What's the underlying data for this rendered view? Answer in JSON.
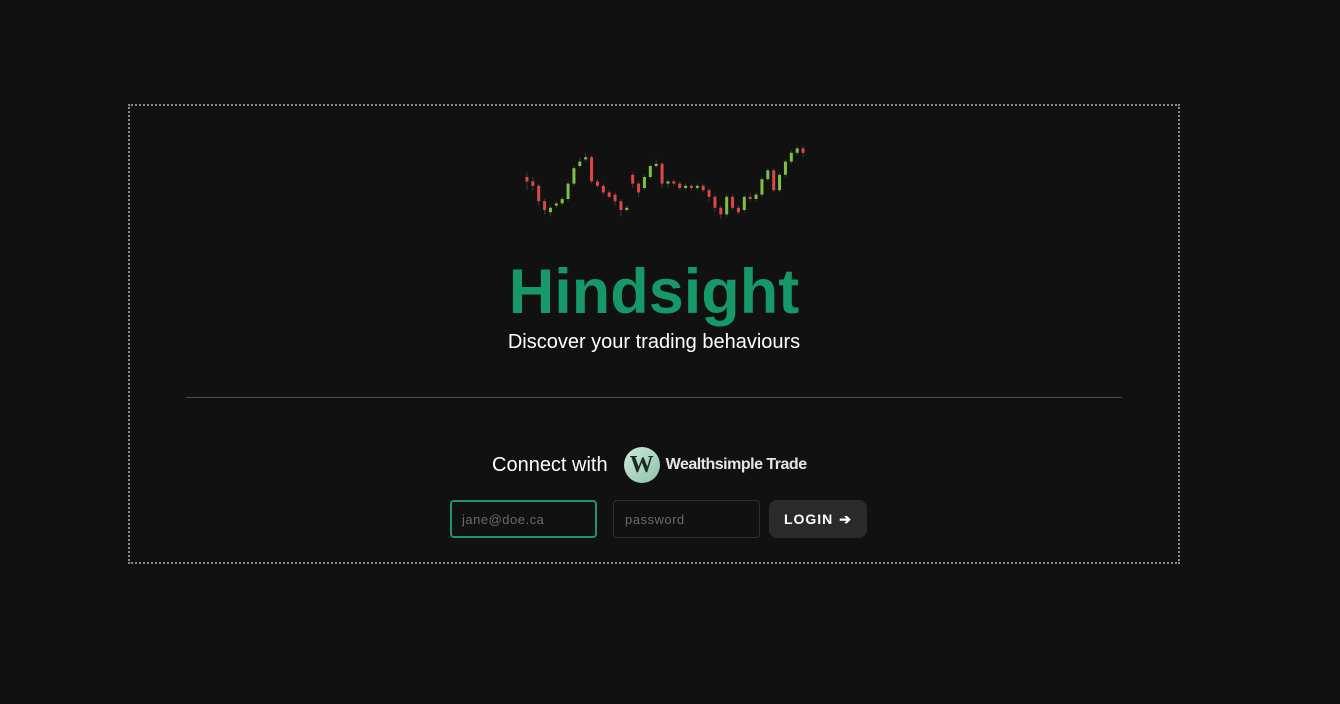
{
  "app": {
    "title": "Hindsight",
    "subtitle": "Discover your trading behaviours"
  },
  "logo": {
    "icon": "candlestick-chart-icon",
    "colors": {
      "up": "#7cc242",
      "down": "#e04646",
      "wick": "#3a3a3a"
    },
    "candles": [
      [
        0.7,
        0.66,
        0.58,
        0.74
      ],
      [
        0.66,
        0.62,
        0.58,
        0.7
      ],
      [
        0.62,
        0.48,
        0.44,
        0.64
      ],
      [
        0.48,
        0.4,
        0.36,
        0.5
      ],
      [
        0.38,
        0.42,
        0.34,
        0.44
      ],
      [
        0.44,
        0.46,
        0.42,
        0.48
      ],
      [
        0.46,
        0.5,
        0.44,
        0.52
      ],
      [
        0.5,
        0.64,
        0.48,
        0.66
      ],
      [
        0.64,
        0.78,
        0.62,
        0.8
      ],
      [
        0.8,
        0.84,
        0.78,
        0.88
      ],
      [
        0.86,
        0.88,
        0.84,
        0.92
      ],
      [
        0.88,
        0.66,
        0.64,
        0.9
      ],
      [
        0.66,
        0.62,
        0.6,
        0.68
      ],
      [
        0.62,
        0.56,
        0.54,
        0.64
      ],
      [
        0.56,
        0.52,
        0.5,
        0.58
      ],
      [
        0.54,
        0.48,
        0.44,
        0.56
      ],
      [
        0.48,
        0.4,
        0.34,
        0.5
      ],
      [
        0.4,
        0.42,
        0.38,
        0.44
      ],
      [
        0.72,
        0.64,
        0.6,
        0.74
      ],
      [
        0.64,
        0.56,
        0.52,
        0.66
      ],
      [
        0.6,
        0.7,
        0.58,
        0.72
      ],
      [
        0.7,
        0.8,
        0.68,
        0.82
      ],
      [
        0.8,
        0.82,
        0.78,
        0.86
      ],
      [
        0.82,
        0.64,
        0.6,
        0.84
      ],
      [
        0.64,
        0.66,
        0.6,
        0.68
      ],
      [
        0.66,
        0.64,
        0.62,
        0.68
      ],
      [
        0.64,
        0.6,
        0.58,
        0.66
      ],
      [
        0.6,
        0.62,
        0.58,
        0.64
      ],
      [
        0.62,
        0.6,
        0.58,
        0.64
      ],
      [
        0.6,
        0.62,
        0.58,
        0.64
      ],
      [
        0.62,
        0.58,
        0.56,
        0.64
      ],
      [
        0.58,
        0.52,
        0.48,
        0.6
      ],
      [
        0.52,
        0.42,
        0.38,
        0.54
      ],
      [
        0.42,
        0.36,
        0.32,
        0.44
      ],
      [
        0.36,
        0.52,
        0.34,
        0.54
      ],
      [
        0.52,
        0.42,
        0.4,
        0.54
      ],
      [
        0.42,
        0.38,
        0.36,
        0.44
      ],
      [
        0.4,
        0.52,
        0.38,
        0.54
      ],
      [
        0.52,
        0.5,
        0.48,
        0.56
      ],
      [
        0.5,
        0.54,
        0.48,
        0.56
      ],
      [
        0.54,
        0.68,
        0.52,
        0.7
      ],
      [
        0.68,
        0.76,
        0.66,
        0.78
      ],
      [
        0.76,
        0.58,
        0.56,
        0.78
      ],
      [
        0.58,
        0.72,
        0.56,
        0.74
      ],
      [
        0.72,
        0.84,
        0.7,
        0.86
      ],
      [
        0.84,
        0.92,
        0.82,
        0.94
      ],
      [
        0.92,
        0.96,
        0.9,
        0.98
      ],
      [
        0.96,
        0.92,
        0.88,
        0.98
      ]
    ]
  },
  "connect": {
    "label": "Connect with",
    "brand_icon": "wealthsimple-w-icon",
    "brand_letter": "W",
    "brand_name": "Wealthsimple Trade"
  },
  "form": {
    "email_placeholder": "jane@doe.ca",
    "password_placeholder": "password",
    "login_label": "LOGIN",
    "login_icon": "arrow-right-icon",
    "login_arrow": "➔"
  },
  "colors": {
    "background": "#111111",
    "accent": "#169869",
    "focus_border": "#1f9470",
    "button_bg": "#2a2a2a"
  }
}
